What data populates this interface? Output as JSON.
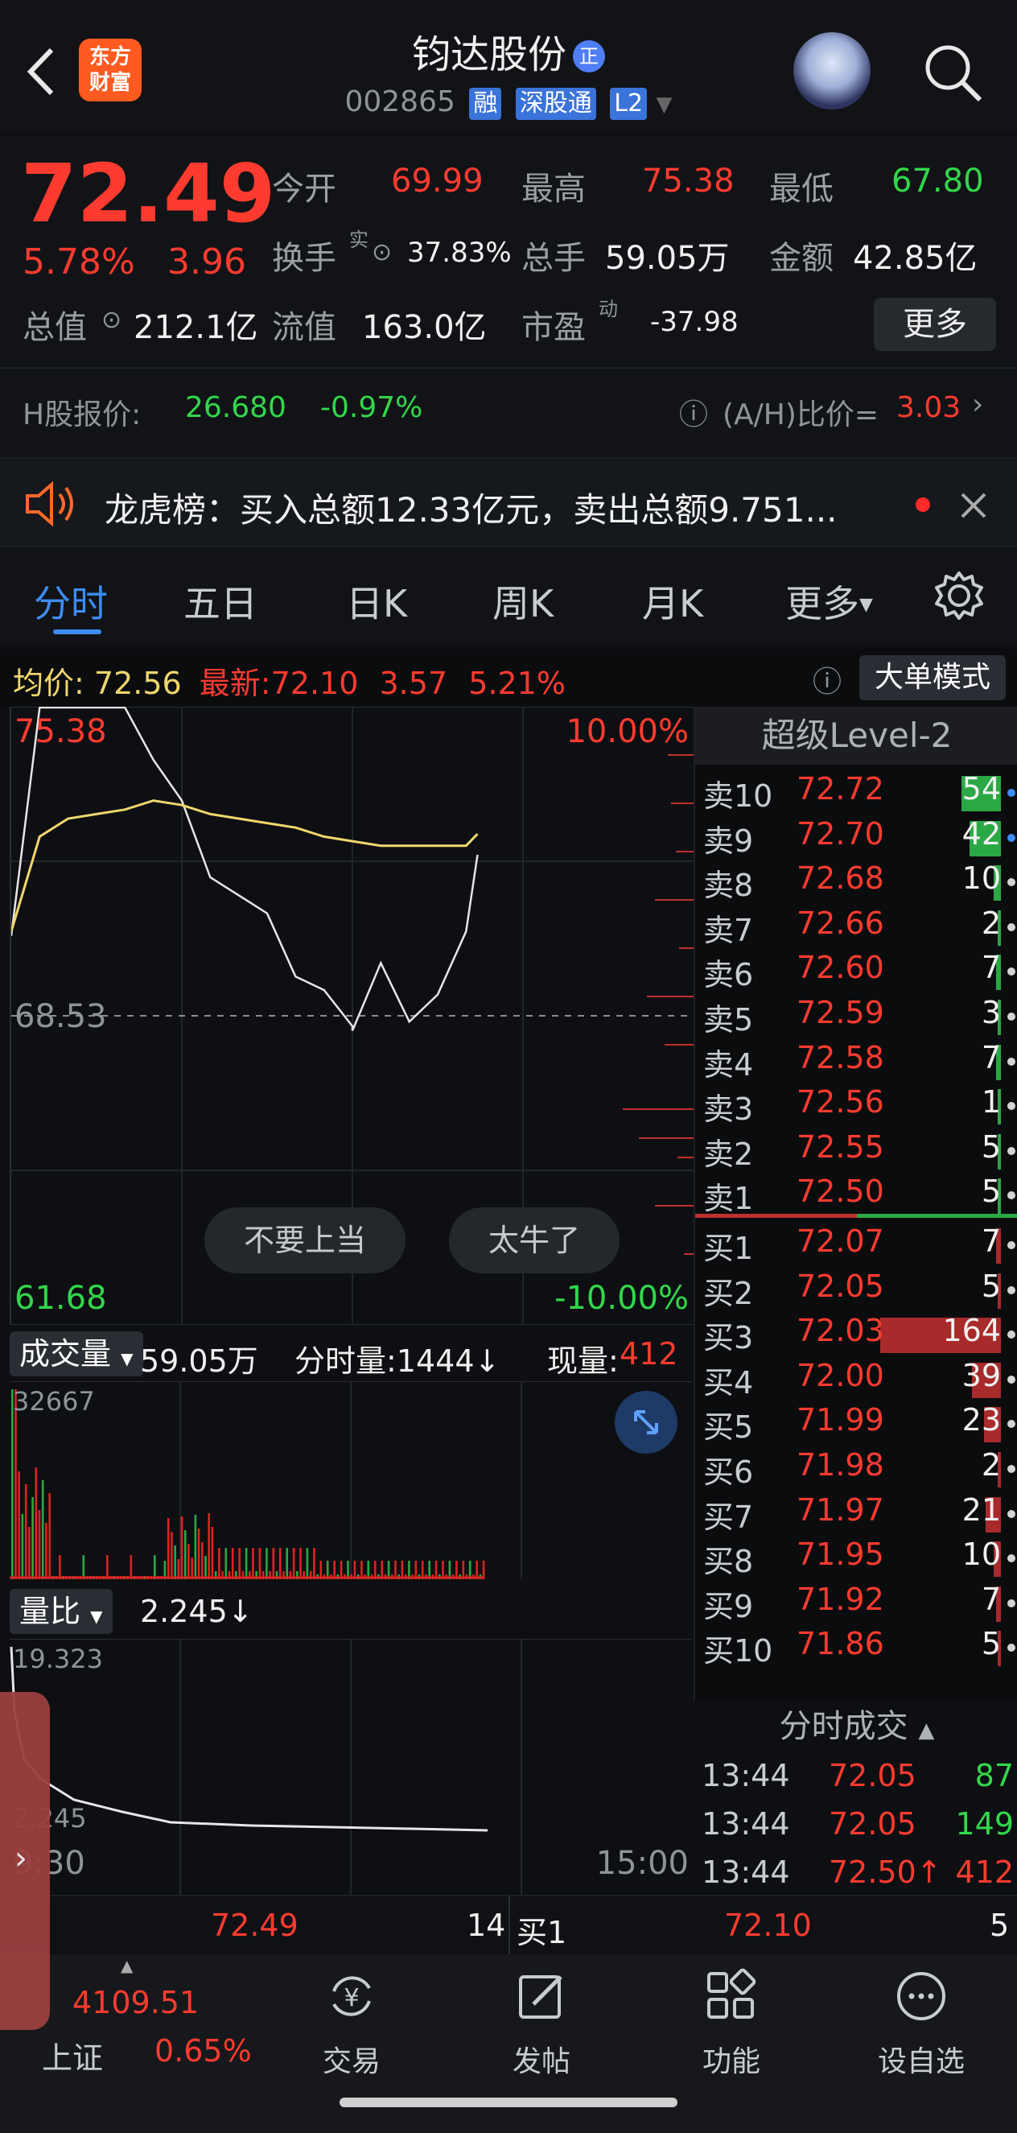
{
  "header": {
    "back_icon": "chevron-left-icon",
    "logo_line1": "东方",
    "logo_line2": "财富",
    "stock_name": "钧达股份",
    "name_badge": "正",
    "stock_code": "002865",
    "tags": [
      "融",
      "深股通",
      "L2"
    ],
    "avatar_icon": "robot-avatar-icon",
    "search_icon": "search-icon"
  },
  "quote": {
    "price": "72.49",
    "change_pct": "5.78%",
    "change_amt": "3.96",
    "open_label": "今开",
    "open_value": "69.99",
    "high_label": "最高",
    "high_value": "75.38",
    "low_label": "最低",
    "low_value": "67.80",
    "turnover_label": "换手",
    "turnover_sup": "实",
    "turnover_value": "37.83%",
    "volume_label": "总手",
    "volume_value": "59.05万",
    "amount_label": "金额",
    "amount_value": "42.85亿",
    "mktcap_label": "总值",
    "mktcap_value": "212.1亿",
    "float_label": "流值",
    "float_value": "163.0亿",
    "pe_label": "市盈",
    "pe_sup": "动",
    "pe_value": "-37.98",
    "more_button": "更多",
    "hshare_label": "H股报价:",
    "hshare_price": "26.680",
    "hshare_change": "-0.97%",
    "ah_label": "(A/H)比价=",
    "ah_value": "3.03"
  },
  "banner": {
    "text": "龙虎榜：买入总额12.33亿元，卖出总额9.751..."
  },
  "tabs": [
    "分时",
    "五日",
    "日K",
    "周K",
    "月K",
    "更多"
  ],
  "chart_info": {
    "avg_label": "均价:",
    "avg_value": "72.56",
    "latest_label": "最新:",
    "latest_value": "72.10",
    "latest_change": "3.57",
    "latest_pct": "5.21%",
    "mode_button": "大单模式"
  },
  "price_axis": {
    "top_price": "75.38",
    "top_pct": "10.00%",
    "mid_price": "68.53",
    "bottom_price": "61.68",
    "bottom_pct": "-10.00%"
  },
  "bubbles": [
    "不要上当",
    "太牛了"
  ],
  "orderbook": {
    "title": "超级Level-2",
    "asks": [
      {
        "label": "卖10",
        "price": "72.72",
        "qty": "54",
        "vol": 0.33
      },
      {
        "label": "卖9",
        "price": "72.70",
        "qty": "42",
        "vol": 0.26
      },
      {
        "label": "卖8",
        "price": "72.68",
        "qty": "10",
        "vol": 0.06
      },
      {
        "label": "卖7",
        "price": "72.66",
        "qty": "2",
        "vol": 0.01
      },
      {
        "label": "卖6",
        "price": "72.60",
        "qty": "7",
        "vol": 0.04
      },
      {
        "label": "卖5",
        "price": "72.59",
        "qty": "3",
        "vol": 0.02
      },
      {
        "label": "卖4",
        "price": "72.58",
        "qty": "7",
        "vol": 0.04
      },
      {
        "label": "卖3",
        "price": "72.56",
        "qty": "1",
        "vol": 0.01
      },
      {
        "label": "卖2",
        "price": "72.55",
        "qty": "5",
        "vol": 0.03
      },
      {
        "label": "卖1",
        "price": "72.50",
        "qty": "5",
        "vol": 0.03
      }
    ],
    "bids": [
      {
        "label": "买1",
        "price": "72.07",
        "qty": "7",
        "vol": 0.04
      },
      {
        "label": "买2",
        "price": "72.05",
        "qty": "5",
        "vol": 0.03
      },
      {
        "label": "买3",
        "price": "72.03",
        "qty": "164",
        "vol": 1.0
      },
      {
        "label": "买4",
        "price": "72.00",
        "qty": "39",
        "vol": 0.24
      },
      {
        "label": "买5",
        "price": "71.99",
        "qty": "23",
        "vol": 0.14
      },
      {
        "label": "买6",
        "price": "71.98",
        "qty": "2",
        "vol": 0.01
      },
      {
        "label": "买7",
        "price": "71.97",
        "qty": "21",
        "vol": 0.13
      },
      {
        "label": "买8",
        "price": "71.95",
        "qty": "10",
        "vol": 0.06
      },
      {
        "label": "买9",
        "price": "71.92",
        "qty": "7",
        "vol": 0.04
      },
      {
        "label": "买10",
        "price": "71.86",
        "qty": "5",
        "vol": 0.03
      }
    ],
    "trades_title": "分时成交",
    "trades": [
      {
        "time": "13:44",
        "price": "72.05",
        "qty": "87"
      },
      {
        "time": "13:44",
        "price": "72.05",
        "qty": "149"
      },
      {
        "time": "13:44",
        "price": "72.50↑",
        "qty": "412"
      }
    ]
  },
  "volume_panel": {
    "dropdown": "成交量",
    "total": "59.05万",
    "minute_label": "分时量:1444↓",
    "current_label": "现量:",
    "current_value": "412",
    "max_label": "32667",
    "expand_icon": "expand-arrows-icon"
  },
  "ratio_panel": {
    "dropdown": "量比",
    "value": "2.245↓",
    "max_label": "19.323",
    "min_label": "2.245",
    "time_start": "9:30",
    "time_end": "15:00"
  },
  "level1_strip": {
    "left_price": "72.49",
    "left_qty": "14",
    "right_label": "买1",
    "right_price": "72.10",
    "right_qty": "5"
  },
  "tabbar": {
    "index_value": "4109.51",
    "index_name": "上证",
    "index_pct": "0.65%",
    "items": [
      {
        "label": "交易",
        "icon": "yen-exchange-icon"
      },
      {
        "label": "发帖",
        "icon": "edit-post-icon"
      },
      {
        "label": "功能",
        "icon": "grid-apps-icon"
      },
      {
        "label": "设自选",
        "icon": "more-dots-icon"
      }
    ]
  },
  "chart_data": {
    "type": "line",
    "title": "",
    "series": [
      {
        "name": "",
        "color": "#e6e6e6",
        "x": [
          "9:30",
          "9:40",
          "9:50",
          "10:00",
          "10:10",
          "10:20",
          "10:30",
          "10:40",
          "10:50",
          "11:00",
          "11:10",
          "11:20",
          "11:30",
          "13:00",
          "13:10",
          "13:20",
          "13:30",
          "13:40",
          "13:44"
        ],
        "values": [
          70.3,
          75.38,
          75.38,
          75.38,
          75.38,
          74.2,
          73.3,
          71.6,
          71.2,
          70.8,
          69.4,
          69.1,
          68.3,
          68.2,
          69.7,
          68.4,
          69.0,
          70.4,
          72.1
        ]
      },
      {
        "name": "均价",
        "color": "#f0d76c",
        "x": [
          "9:30",
          "9:40",
          "9:50",
          "10:00",
          "10:10",
          "10:20",
          "10:30",
          "10:40",
          "10:50",
          "11:00",
          "11:10",
          "11:20",
          "11:30",
          "13:00",
          "13:10",
          "13:20",
          "13:30",
          "13:40",
          "13:44"
        ],
        "values": [
          70.4,
          72.5,
          72.9,
          73.0,
          73.1,
          73.3,
          73.2,
          73.0,
          72.9,
          72.8,
          72.7,
          72.5,
          72.4,
          72.4,
          72.3,
          72.3,
          72.3,
          72.3,
          72.56
        ]
      }
    ],
    "ylim": [
      61.68,
      75.38
    ],
    "xlim": [
      "9:30",
      "15:00"
    ],
    "reference_line": 68.53
  }
}
